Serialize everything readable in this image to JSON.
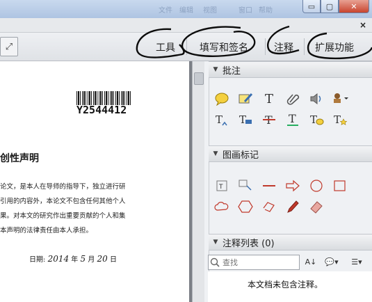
{
  "window": {
    "title_ghost": [
      "文件",
      "编辑",
      "视图",
      "窗口",
      "帮助"
    ],
    "min_glyph": "▭",
    "max_glyph": "▢",
    "close_glyph": "✕",
    "sub_close_glyph": "×"
  },
  "toolbar": {
    "fit_glyph": "⤢",
    "tools_label": "工具",
    "fill_sign_label": "填写和签名",
    "comment_label": "注释",
    "extend_label": "扩展功能"
  },
  "document": {
    "barcode_number": "Y2544412",
    "title": "创性声明",
    "lines": [
      "论文，是本人在导师的指导下，独立进行研",
      "引用的内容外，本论文不包含任何其他个人",
      "果。对本文的研究作出重要贡献的个人和集",
      "本声明的法律责任由本人承担。"
    ],
    "date_label": "日期:",
    "date_year": "2014",
    "date_year_unit": "年",
    "date_month": "5",
    "date_month_unit": "月",
    "date_day": "20",
    "date_day_unit": "日"
  },
  "panel": {
    "sec1_label": "批注",
    "sec2_label": "图画标记",
    "sec3_label": "注释列表 (0)",
    "collapse_glyph": "▼",
    "search_placeholder": "查找",
    "sort_glyph": "A↓",
    "filter_glyph": "💬▾",
    "options_glyph": "☰▾",
    "empty_message": "本文档未包含注释。",
    "text_tool_glyph": "T"
  },
  "colors": {
    "accent_red": "#c0392b",
    "icon_blue": "#3a6fb0",
    "note_yellow": "#f4d03f",
    "stamp_brown": "#8a5a2b"
  }
}
